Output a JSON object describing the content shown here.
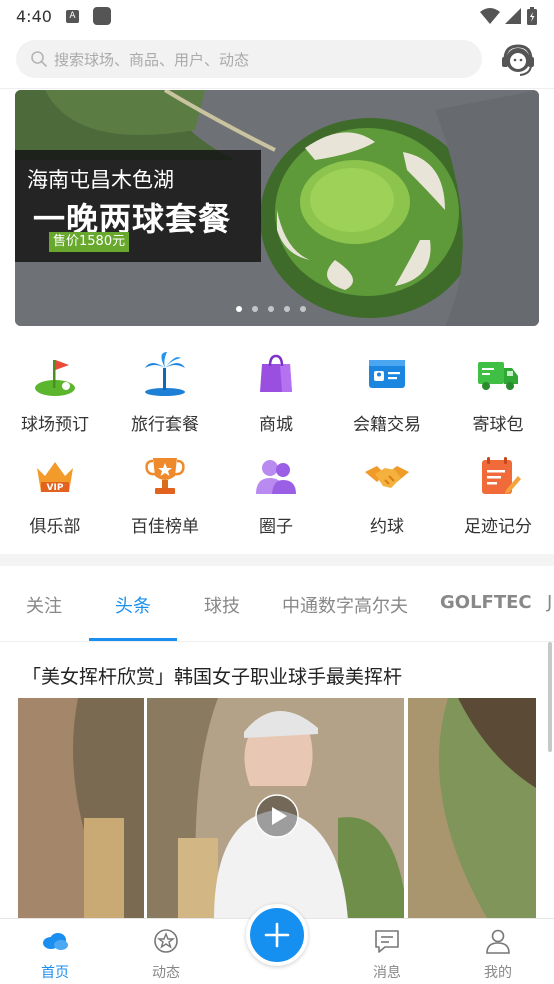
{
  "status_bar": {
    "time": "4:40",
    "a_icon": "A"
  },
  "search": {
    "placeholder": "搜索球场、商品、用户、动态"
  },
  "banner": {
    "subtitle": "海南屯昌木色湖",
    "title": "一晚两球套餐",
    "price": "售价1580元",
    "dots_total": 5,
    "active_dot": 1
  },
  "grid": [
    {
      "label": "球场预订",
      "icon": "golf-flag-icon"
    },
    {
      "label": "旅行套餐",
      "icon": "palm-tree-icon"
    },
    {
      "label": "商城",
      "icon": "shopping-bag-icon"
    },
    {
      "label": "会籍交易",
      "icon": "member-card-icon"
    },
    {
      "label": "寄球包",
      "icon": "delivery-truck-icon"
    },
    {
      "label": "俱乐部",
      "icon": "vip-crown-icon"
    },
    {
      "label": "百佳榜单",
      "icon": "trophy-icon"
    },
    {
      "label": "圈子",
      "icon": "users-icon"
    },
    {
      "label": "约球",
      "icon": "handshake-icon"
    },
    {
      "label": "足迹记分",
      "icon": "scorecard-icon"
    }
  ],
  "tabs": [
    "关注",
    "头条",
    "球技",
    "中通数字高尔夫",
    "GOLFTEC",
    "J"
  ],
  "active_tab": 1,
  "article": {
    "title": "「美女挥杆欣赏」韩国女子职业球手最美挥杆"
  },
  "bottom_nav": [
    {
      "label": "首页",
      "icon": "home-cloud-icon",
      "active": true
    },
    {
      "label": "动态",
      "icon": "star-circle-icon",
      "active": false
    },
    {
      "label": "消息",
      "icon": "message-icon",
      "active": false
    },
    {
      "label": "我的",
      "icon": "person-icon",
      "active": false
    }
  ],
  "colors": {
    "accent": "#1a8ff0",
    "price_tag": "#67a82d"
  }
}
